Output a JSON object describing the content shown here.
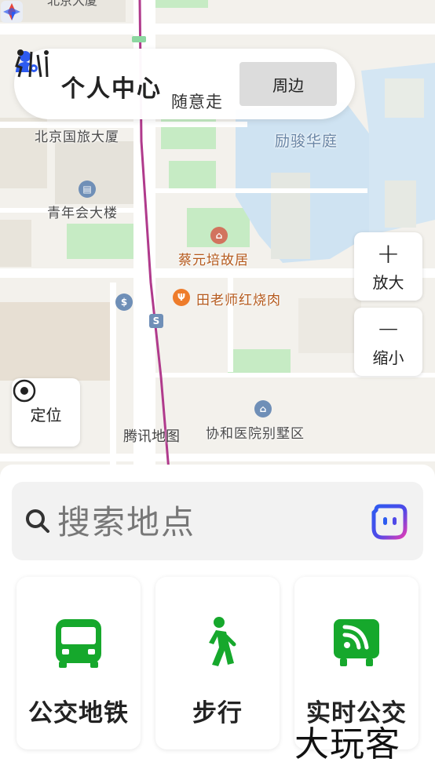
{
  "map": {
    "pois": [
      {
        "label": "北京国旅大厦"
      },
      {
        "label": "励骏华庭"
      },
      {
        "label": "青年会大楼"
      },
      {
        "label": "蔡元培故居"
      },
      {
        "label": "田老师红烧肉"
      },
      {
        "label": "协和医院别墅区"
      }
    ],
    "logo_label": "腾讯地图"
  },
  "top_panel": {
    "profile_label": "个人中心",
    "walk_label": "随意走",
    "nearby_label": "周边"
  },
  "zoom": {
    "in_symbol": "+",
    "in_label": "放大",
    "out_symbol": "−",
    "out_label": "缩小"
  },
  "locate": {
    "label": "定位"
  },
  "search": {
    "placeholder": "搜索地点"
  },
  "cards": [
    {
      "label": "公交地铁",
      "icon": "bus-icon"
    },
    {
      "label": "步行",
      "icon": "walker-icon"
    },
    {
      "label": "实时公交",
      "icon": "realtime-bus-icon"
    }
  ],
  "watermark": "大玩客",
  "colors": {
    "accent_green": "#16a82c",
    "assistant_blue": "#2d5bf0",
    "map_road_purple": "#b03a8c",
    "map_green": "#c6ebc4",
    "map_water": "#cfe3f2"
  }
}
